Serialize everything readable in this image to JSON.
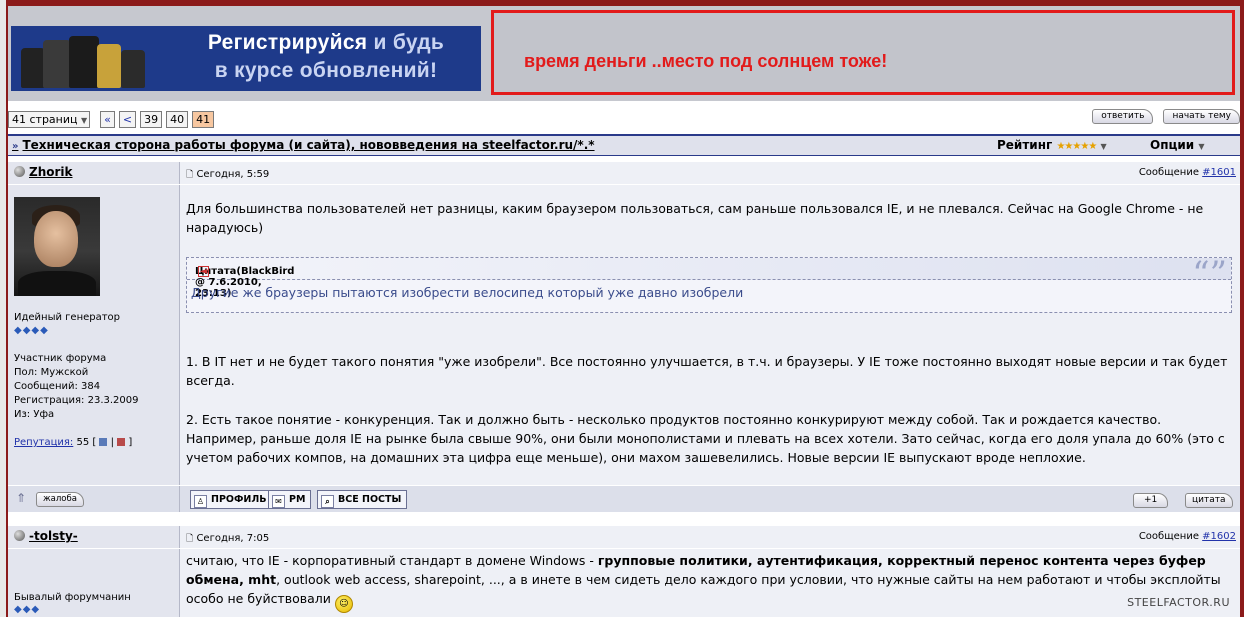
{
  "banner": {
    "line1a": "Регистрируйся",
    "line1b": "и будь",
    "line2": "в курсе обновлений!",
    "ad_text": "время деньги ..место под солнцем тоже!"
  },
  "pager": {
    "pages_select": "41 страниц",
    "first": "«",
    "prev": "<",
    "pages": [
      "39",
      "40",
      "41"
    ],
    "current": "41"
  },
  "top_buttons": {
    "reply": "ответить",
    "new_topic": "начать тему"
  },
  "topic": {
    "title": "Техническая сторона работы форума (и сайта), нововведения на steelfactor.ru/*.*",
    "rating_label": "Рейтинг",
    "rating_stars": "★★★★★",
    "options_label": "Опции"
  },
  "posts": [
    {
      "author": "Zhorik",
      "time": "Сегодня, 5:59",
      "msg_label": "Сообщение",
      "msg_num": "#1601",
      "rank": "Идейный генератор",
      "group": "Участник форума",
      "gender": "Пол: Мужской",
      "count": "Сообщений: 384",
      "reg": "Регистрация: 23.3.2009",
      "from": "Из: Уфа",
      "rep_label": "Репутация:",
      "rep_value": "55",
      "p1": "Для большинства пользователей нет разницы, каким браузером пользоваться, сам раньше пользовался IE, и не плевался. Сейчас на Google Chrome - не нарадуюсь)",
      "quote_head": "Цитата(BlackBird @ 7.6.2010, 23:13)",
      "quote_body": "Другие же браузеры пытаются изобрести велосипед который уже давно изобрели",
      "p2": "1. В IT нет и не будет такого понятия \"уже изобрели\". Все постоянно улучшается, в т.ч. и браузеры. У IE тоже постоянно выходят новые версии и так будет всегда.",
      "p3": "2. Есть такое понятие - конкуренция. Так и должно быть - несколько продуктов постоянно конкурируют между собой. Так и рождается качество. Например, раньше доля IE на рынке была свыше 90%, они были монополистами и плевать на всех хотели. Зато сейчас, когда его доля упала до 60% (это с учетом рабочих компов, на домашних эта цифра еще меньше), они махом зашевелились. Новые версии IE выпускают вроде неплохие.",
      "complaint": "жалоба",
      "profile": "ПРОФИЛЬ",
      "pm": "PM",
      "all_posts": "ВСЕ ПОСТЫ",
      "plus": "+1",
      "quote_btn": "цитата"
    },
    {
      "author": "-tolsty-",
      "time": "Сегодня, 7:05",
      "msg_label": "Сообщение",
      "msg_num": "#1602",
      "rank": "Бывалый форумчанин",
      "p1_a": "считаю, что IE - корпоративный стандарт в домене Windows - ",
      "p1_b": "групповые политики, аутентификация, корректный перенос контента через буфер обмена, mht",
      "p1_c": ", outlook web access, sharepoint, ..., а в инете в чем сидеть дело каждого при условии, что нужные сайты на нем работают и чтобы эксплойты особо не буйствовали"
    }
  ],
  "watermark": "STEELFACTOR.RU"
}
